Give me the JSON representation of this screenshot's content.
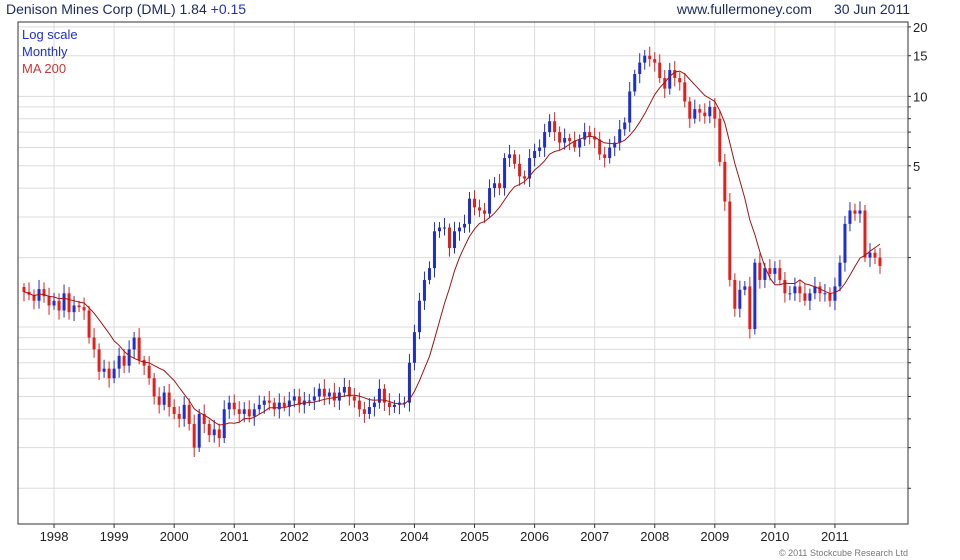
{
  "header": {
    "title": "Denison Mines Corp (DML)",
    "price": "1.84",
    "change": "+0.15",
    "website": "www.fullermoney.com",
    "date": "30 Jun 2011"
  },
  "legend": {
    "scale": "Log scale",
    "period": "Monthly",
    "ma": "MA 200"
  },
  "copyright": "© 2011 Stockcube Research Ltd",
  "colors": {
    "up": "#1f2fcf",
    "down": "#e0201c",
    "ma": "#a01414",
    "grid": "#dcdcdc",
    "axis": "#333333",
    "text_header": "#1a2a5e"
  },
  "chart_data": {
    "type": "candlestick",
    "scale": "log",
    "interval": "monthly",
    "grid": true,
    "legend_position": "top-left",
    "y_ticks": [
      5,
      10,
      15,
      20
    ],
    "y_range": [
      0.14,
      21
    ],
    "x_tick_labels": [
      "1998",
      "1999",
      "2000",
      "2001",
      "2002",
      "2003",
      "2004",
      "2005",
      "2006",
      "2007",
      "2008",
      "2009",
      "2010",
      "2011"
    ],
    "x_start": "1997-07",
    "moving_average_label": "MA 200",
    "closes": [
      1.42,
      1.38,
      1.3,
      1.46,
      1.36,
      1.24,
      1.3,
      1.18,
      1.4,
      1.16,
      1.24,
      1.22,
      1.18,
      0.9,
      0.8,
      0.64,
      0.66,
      0.6,
      0.66,
      0.75,
      0.68,
      0.8,
      0.9,
      0.72,
      0.68,
      0.6,
      0.5,
      0.46,
      0.52,
      0.45,
      0.42,
      0.4,
      0.46,
      0.38,
      0.3,
      0.42,
      0.38,
      0.34,
      0.36,
      0.33,
      0.44,
      0.47,
      0.44,
      0.42,
      0.44,
      0.41,
      0.44,
      0.46,
      0.48,
      0.47,
      0.44,
      0.47,
      0.45,
      0.48,
      0.5,
      0.46,
      0.48,
      0.48,
      0.5,
      0.54,
      0.5,
      0.52,
      0.48,
      0.52,
      0.55,
      0.5,
      0.48,
      0.44,
      0.42,
      0.45,
      0.47,
      0.54,
      0.47,
      0.45,
      0.46,
      0.47,
      0.47,
      0.7,
      0.95,
      1.3,
      1.6,
      1.8,
      2.6,
      2.7,
      2.7,
      2.2,
      2.6,
      2.7,
      2.8,
      3.6,
      3.3,
      3.2,
      3.1,
      4.0,
      4.2,
      4.0,
      5.4,
      5.6,
      5.1,
      4.5,
      4.4,
      5.4,
      5.8,
      6.0,
      7.0,
      7.8,
      7.0,
      6.3,
      6.6,
      6.4,
      6.0,
      6.5,
      7.0,
      6.7,
      6.5,
      5.6,
      5.4,
      6.0,
      6.3,
      7.2,
      7.7,
      10.5,
      12.5,
      14.0,
      15.0,
      14.5,
      14.0,
      12.0,
      10.8,
      13.0,
      12.0,
      11.5,
      9.5,
      8.0,
      8.8,
      8.5,
      8.2,
      9.0,
      8.0,
      5.2,
      3.5,
      1.6,
      1.2,
      1.45,
      1.5,
      0.98,
      1.9,
      1.6,
      1.8,
      1.7,
      1.8,
      1.6,
      1.4,
      1.4,
      1.5,
      1.4,
      1.3,
      1.4,
      1.5,
      1.4,
      1.4,
      1.3,
      1.5,
      1.9,
      2.8,
      3.2,
      3.1,
      3.2,
      2.0,
      2.1,
      2.0,
      1.84
    ]
  }
}
